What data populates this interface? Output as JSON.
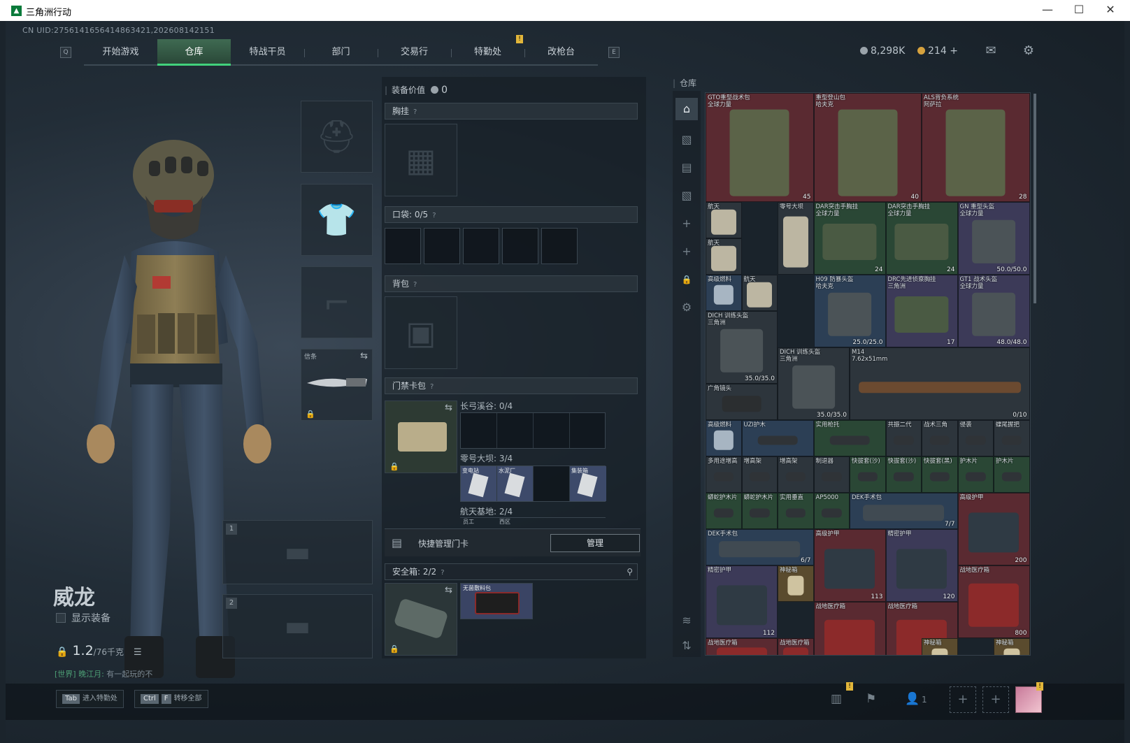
{
  "window": {
    "title": "三角洲行动",
    "minimize": "—",
    "maximize": "☐",
    "close": "✕"
  },
  "uid": "CN UID:2756141656414863421,202608142151",
  "nav": {
    "left_key": "Q",
    "right_key": "E",
    "tabs": [
      "开始游戏",
      "仓库",
      "特战干员",
      "部门",
      "交易行",
      "特勤处",
      "改枪台"
    ],
    "active": "仓库"
  },
  "currency": {
    "silver": "8,298K",
    "gold": "214",
    "plus": "+"
  },
  "character": {
    "name": "威龙",
    "show_equipment": "显示装备",
    "weight": "1.2",
    "weight_max": "/76千克"
  },
  "melee": {
    "label": "信条"
  },
  "weapon_slots": [
    "1",
    "2"
  ],
  "chat": {
    "channel": "[世界] 晚江月:",
    "message": "有一起玩的不"
  },
  "middle": {
    "equip_value_label": "装备价值",
    "equip_value": "0",
    "chest_rig": "胸挂",
    "pockets_label": "口袋:",
    "pockets_value": "0/5",
    "backpack": "背包",
    "keycard_bag": "门禁卡包",
    "key_groups": [
      {
        "name": "长弓溪谷: 0/4"
      },
      {
        "name": "零号大坝: 3/4"
      },
      {
        "name": "航天基地: 2/4"
      }
    ],
    "zero_dam_cards": [
      "变电站",
      "水泥厂",
      "",
      "集装箱"
    ],
    "spaceport_cards": [
      "员工",
      "西区"
    ],
    "quick_manage": "快捷管理门卡",
    "manage_btn": "管理",
    "safe_box_label": "安全箱:",
    "safe_box_value": "2/2",
    "safe_item": "无菌敷料包"
  },
  "warehouse": {
    "title": "仓库",
    "items": [
      {
        "name": "GTO重型战术包\n全球力量",
        "badge": "45",
        "rarity": "red",
        "icon": "backpack-icon"
      },
      {
        "name": "重型登山包\n哈夫克",
        "badge": "40",
        "rarity": "red",
        "icon": "backpack-icon"
      },
      {
        "name": "ALS背负系统\n阿萨拉",
        "badge": "28",
        "rarity": "red",
        "icon": "backpack-icon"
      },
      {
        "name": "航天",
        "badge": "",
        "rarity": "gray",
        "icon": "map-icon"
      },
      {
        "name": "零号大坝",
        "badge": "",
        "rarity": "gray",
        "icon": "map-icon"
      },
      {
        "name": "DAR突击手胸挂\n全球力量",
        "badge": "24",
        "rarity": "green",
        "icon": "vest-icon"
      },
      {
        "name": "DAR突击手胸挂\n全球力量",
        "badge": "24",
        "rarity": "green",
        "icon": "vest-icon"
      },
      {
        "name": "GN 重型头盔\n全球力量",
        "badge": "50.0/50.0",
        "rarity": "purple",
        "icon": "helmet-icon"
      },
      {
        "name": "航天",
        "badge": "",
        "rarity": "gray",
        "icon": "map-icon"
      },
      {
        "name": "高级燃料",
        "badge": "",
        "rarity": "blue",
        "icon": "can-icon"
      },
      {
        "name": "航天",
        "badge": "",
        "rarity": "gray",
        "icon": "map-icon"
      },
      {
        "name": "H09 防暴头盔\n哈夫克",
        "badge": "25.0/25.0",
        "rarity": "blue",
        "icon": "helmet-icon"
      },
      {
        "name": "DRC先进侦察胸挂\n三角洲",
        "badge": "17",
        "rarity": "purple",
        "icon": "vest-icon"
      },
      {
        "name": "GT1 战术头盔\n全球力量",
        "badge": "48.0/48.0",
        "rarity": "purple",
        "icon": "helmet-icon"
      },
      {
        "name": "DICH 训练头盔\n三角洲",
        "badge": "35.0/35.0",
        "rarity": "gray",
        "icon": "helmet-icon"
      },
      {
        "name": "DICH 训练头盔\n三角洲",
        "badge": "35.0/35.0",
        "rarity": "gray",
        "icon": "helmet-icon"
      },
      {
        "name": "M14\n7.62x51mm",
        "badge": "0/10",
        "rarity": "gray",
        "icon": "rifle-icon"
      },
      {
        "name": "广角镜头",
        "badge": "",
        "rarity": "gray",
        "icon": "lens-icon"
      },
      {
        "name": "高级燃料",
        "badge": "",
        "rarity": "blue",
        "icon": "can-icon"
      },
      {
        "name": "UZI护木",
        "badge": "",
        "rarity": "blue",
        "icon": "part-icon"
      },
      {
        "name": "实用枪托",
        "badge": "",
        "rarity": "green",
        "icon": "part-icon"
      },
      {
        "name": "共振二代",
        "badge": "",
        "rarity": "gray",
        "icon": "part-icon"
      },
      {
        "name": "战术三角",
        "badge": "",
        "rarity": "gray",
        "icon": "part-icon"
      },
      {
        "name": "侵袭",
        "badge": "",
        "rarity": "gray",
        "icon": "part-icon"
      },
      {
        "name": "蝶尾握把",
        "badge": "",
        "rarity": "gray",
        "icon": "part-icon"
      },
      {
        "name": "多用途增高",
        "badge": "",
        "rarity": "gray",
        "icon": "part-icon"
      },
      {
        "name": "增高架",
        "badge": "",
        "rarity": "gray",
        "icon": "part-icon"
      },
      {
        "name": "增高架",
        "badge": "",
        "rarity": "gray",
        "icon": "part-icon"
      },
      {
        "name": "制退器",
        "badge": "",
        "rarity": "gray",
        "icon": "part-icon"
      },
      {
        "name": "快拔套(沙)",
        "badge": "",
        "rarity": "green",
        "icon": "part-icon"
      },
      {
        "name": "快拔套(沙)",
        "badge": "",
        "rarity": "green",
        "icon": "part-icon"
      },
      {
        "name": "快拔套(黑)",
        "badge": "",
        "rarity": "green",
        "icon": "part-icon"
      },
      {
        "name": "护木片",
        "badge": "",
        "rarity": "green",
        "icon": "part-icon"
      },
      {
        "name": "护木片",
        "badge": "",
        "rarity": "green",
        "icon": "part-icon"
      },
      {
        "name": "蟒蛇护木片",
        "badge": "",
        "rarity": "green",
        "icon": "part-icon"
      },
      {
        "name": "蟒蛇护木片",
        "badge": "",
        "rarity": "green",
        "icon": "part-icon"
      },
      {
        "name": "实用垂直",
        "badge": "",
        "rarity": "green",
        "icon": "part-icon"
      },
      {
        "name": "AP5000",
        "badge": "",
        "rarity": "green",
        "icon": "part-icon"
      },
      {
        "name": "DEK手术包",
        "badge": "7/7",
        "rarity": "blue",
        "icon": "kit-icon"
      },
      {
        "name": "高级护甲",
        "badge": "200",
        "rarity": "red",
        "icon": "armor-icon"
      },
      {
        "name": "DEK手术包",
        "badge": "6/7",
        "rarity": "blue",
        "icon": "kit-icon"
      },
      {
        "name": "高级护甲",
        "badge": "113",
        "rarity": "red",
        "icon": "armor-icon"
      },
      {
        "name": "精密护甲",
        "badge": "120",
        "rarity": "purple",
        "icon": "armor-icon"
      },
      {
        "name": "精密护甲",
        "badge": "112",
        "rarity": "purple",
        "icon": "armor-icon"
      },
      {
        "name": "神秘箱",
        "badge": "",
        "rarity": "gold",
        "icon": "bag-icon"
      },
      {
        "name": "战地医疗箱",
        "badge": "",
        "rarity": "red",
        "icon": "medkit-icon"
      },
      {
        "name": "战地医疗箱",
        "badge": "",
        "rarity": "red",
        "icon": "medkit-icon"
      },
      {
        "name": "战地医疗箱",
        "badge": "800",
        "rarity": "red",
        "icon": "medkit-icon"
      },
      {
        "name": "神秘箱",
        "badge": "",
        "rarity": "gold",
        "icon": "bag-icon"
      },
      {
        "name": "战地医疗箱",
        "badge": "",
        "rarity": "red",
        "icon": "medkit-icon"
      },
      {
        "name": "战地医疗箱",
        "badge": "",
        "rarity": "red",
        "icon": "medkit-icon"
      },
      {
        "name": "神秘箱",
        "badge": "",
        "rarity": "gold",
        "icon": "bag-icon"
      }
    ]
  },
  "bottom": {
    "tab_key": "Tab",
    "tab_label": "进入特勤处",
    "ctrl_key": "Ctrl",
    "f_key": "F",
    "ctrl_label": "转移全部",
    "squad_count": "1",
    "plus": "+"
  },
  "colors": {
    "accent": "#42d27c",
    "red_rarity": "#5a2a31",
    "gold_rarity": "#5a4b2e",
    "purple_rarity": "#3c3a58",
    "blue_rarity": "#2c3f55",
    "green_rarity": "#2a4735"
  }
}
